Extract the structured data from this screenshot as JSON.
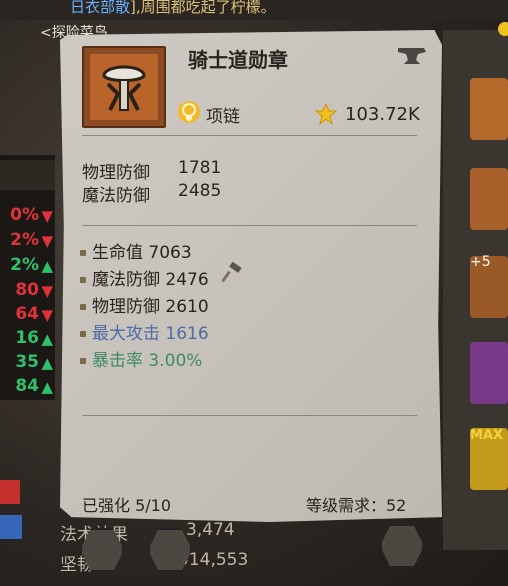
{
  "background": {
    "top_text_blue": "日衣部散",
    "top_text_rest": "],周围都吃起了柠檬。",
    "subtitle": "<探险菜鸟",
    "left_stats": [
      {
        "value": "0%",
        "trend": "down"
      },
      {
        "value": "2%",
        "trend": "down"
      },
      {
        "value": "2%",
        "trend": "up"
      },
      {
        "value": "80",
        "trend": "down"
      },
      {
        "value": "64",
        "trend": "down"
      },
      {
        "value": "16",
        "trend": "up"
      },
      {
        "value": "35",
        "trend": "up"
      },
      {
        "value": "84",
        "trend": "up"
      }
    ],
    "bottom_line1_label": "法术效果",
    "bottom_line1_value": "3,474",
    "bottom_line2_label": "坚韧",
    "bottom_line2_value": "514,553",
    "slot_plus_text": "+5",
    "slot_max_text": "MAX"
  },
  "tooltip": {
    "item_name": "骑士道勋章",
    "item_type": "项链",
    "power": "103.72K",
    "base_stats": [
      {
        "label": "物理防御",
        "value": "1781"
      },
      {
        "label": "魔法防御",
        "value": "2485"
      }
    ],
    "bonus_stats": [
      {
        "text": "生命值 7063",
        "color": "dark"
      },
      {
        "text": "魔法防御 2476",
        "color": "dark"
      },
      {
        "text": "物理防御 2610",
        "color": "dark"
      },
      {
        "text": "最大攻击 1616",
        "color": "blue"
      },
      {
        "text": "暴击率 3.00%",
        "color": "green"
      }
    ],
    "enhance_text": "已强化 5/10",
    "level_requirement": "等级需求：52"
  },
  "icons": {
    "item": "medal-icon",
    "type": "necklace-icon",
    "power": "star-icon",
    "forge": "anvil-icon",
    "reforge": "hammer-icon"
  }
}
